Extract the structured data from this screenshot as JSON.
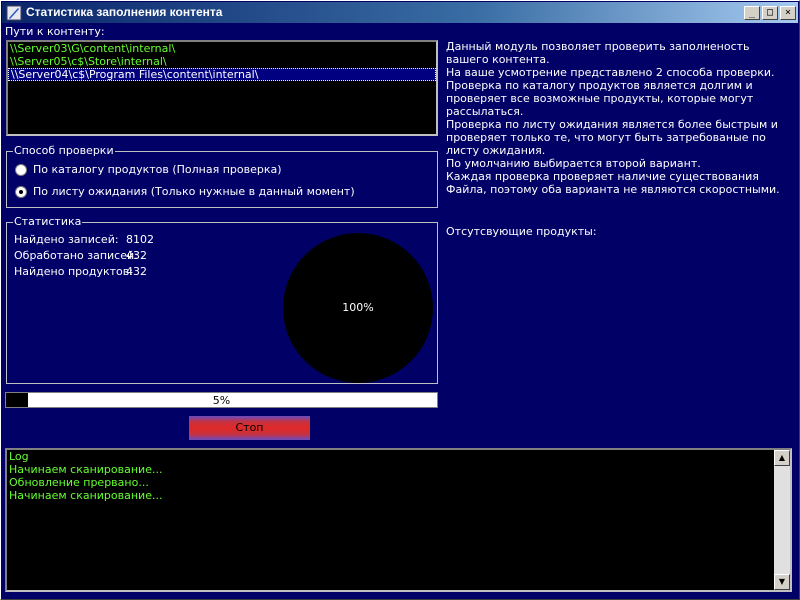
{
  "window": {
    "title": "Статистика заполнения контента",
    "controls": {
      "minimize": "_",
      "maximize": "□",
      "close": "×"
    }
  },
  "paths": {
    "label": "Пути к контенту:",
    "items": [
      {
        "text": "\\\\Server03\\G\\content\\internal\\",
        "color": "#66ff33"
      },
      {
        "text": "\\\\Server05\\c$\\Store\\internal\\",
        "color": "#66ff33"
      },
      {
        "text": "\\\\Server04\\c$\\Program Files\\content\\internal\\",
        "color": "#ffffff",
        "selected": true
      }
    ]
  },
  "method": {
    "title": "Способ проверки",
    "options": [
      {
        "label": "По каталогу продуктов (Полная проверка)",
        "checked": false
      },
      {
        "label": "По листу ожидания (Только нужные в данный момент)",
        "checked": true
      }
    ]
  },
  "stats": {
    "title": "Статистика",
    "rows": [
      {
        "label": "Найдено записей:",
        "value": "8102"
      },
      {
        "label": "Обработано записей:",
        "value": "432"
      },
      {
        "label": "Найдено продуктов:",
        "value": "432"
      }
    ],
    "pie_label": "100%"
  },
  "progress": {
    "value": 0.05,
    "text": "5%"
  },
  "stop_button": "Стоп",
  "description": [
    "Данный модуль позволяет проверить заполненость вашего контента.",
    "На ваше усмотрение представлено 2 способа проверки.",
    "Проверка по каталогу продуктов является долгим и проверяет все возможные продукты, которые могут рассылаться.",
    "Проверка по листу ожидания является более быстрым и проверяет только те, что могут быть затребованые по листу ожидания.",
    "По умолчанию выбирается второй вариант.",
    "Каждая проверка проверяет наличие существования Файла, поэтому оба варианта не являются скоростными."
  ],
  "missing_products_label": "Отсутсвующие продукты:",
  "log": {
    "lines": [
      "Log",
      "Начинаем сканирование...",
      "Обновление прервано...",
      "Начинаем сканирование..."
    ],
    "scroll_up": "▲",
    "scroll_down": "▼"
  }
}
